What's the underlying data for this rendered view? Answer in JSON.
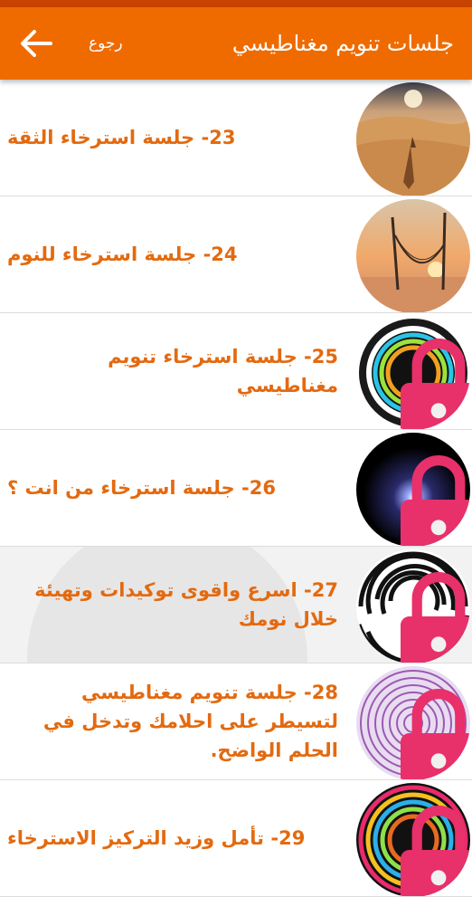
{
  "header": {
    "title": "جلسات تنويم مغناطيسي",
    "back_label": "رجوع"
  },
  "colors": {
    "status_bar": "#c94300",
    "app_bar": "#ef6b00",
    "item_title": "#e36a10",
    "lock": "#e8306a"
  },
  "sessions": [
    {
      "title": "23- جلسة استرخاء الثقة",
      "thumbnail": "desert-sunset-image",
      "locked": false
    },
    {
      "title": "24- جلسة استرخاء للنوم",
      "thumbnail": "hammock-sunset-image",
      "locked": false
    },
    {
      "title": "25- جلسة استرخاء تنويم مغناطيسي",
      "thumbnail": "rainbow-rings-image",
      "locked": true
    },
    {
      "title": "26- جلسة استرخاء من انت ؟",
      "thumbnail": "black-glow-image",
      "locked": true
    },
    {
      "title": "27- اسرع واقوى توكيدات وتهيئة خلال نومك",
      "thumbnail": "spiral-image",
      "locked": true
    },
    {
      "title": "28- جلسة تنويم مغناطيسي لتسيطر على احلامك وتدخل في الحلم الواضح.",
      "thumbnail": "purple-rings-image",
      "locked": true
    },
    {
      "title": "29- تأمل وزيد التركيز الاسترخاء",
      "thumbnail": "color-spiral-image",
      "locked": true
    }
  ]
}
